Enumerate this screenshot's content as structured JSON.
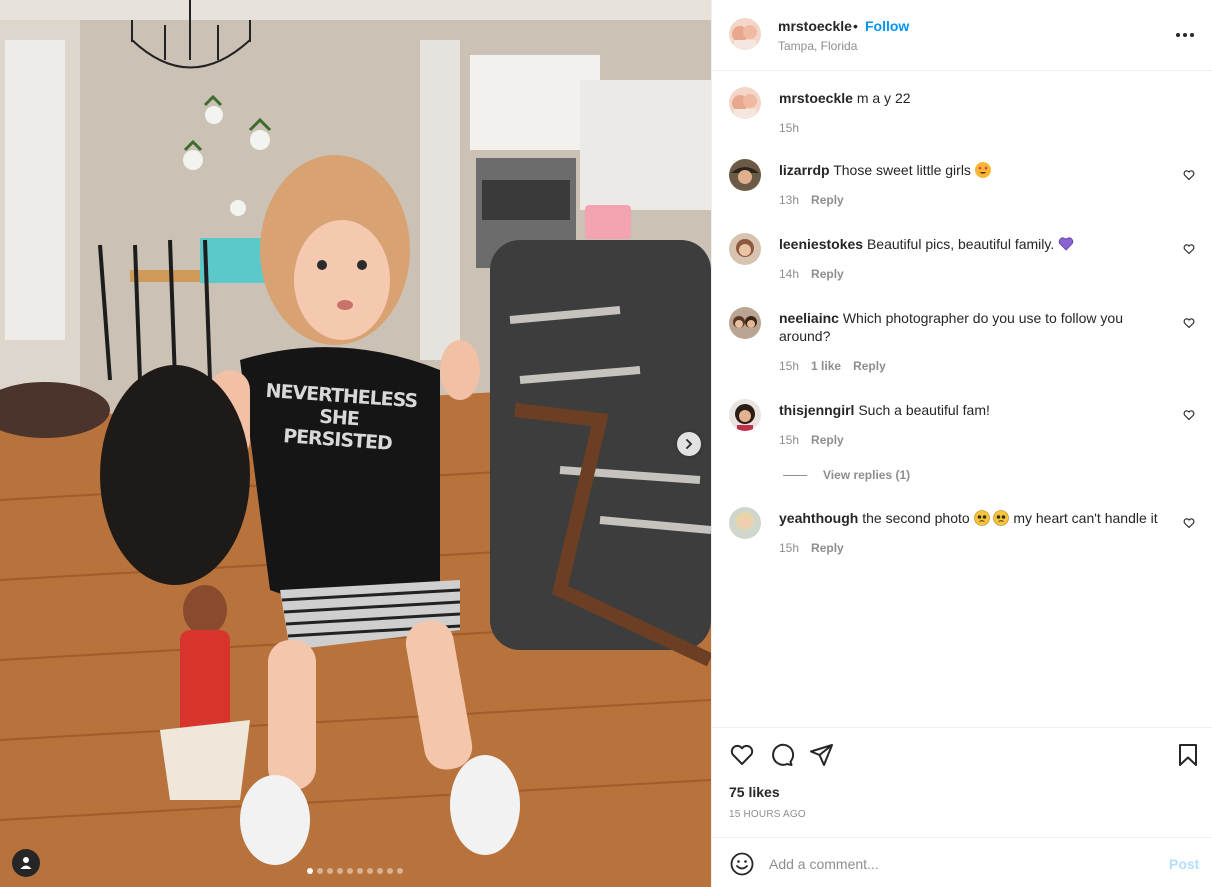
{
  "post": {
    "author": "mrstoeckle",
    "separator": "•",
    "follow_label": "Follow",
    "location": "Tampa, Florida",
    "caption": "m a y 22",
    "caption_time": "15h",
    "shirt_text": "NEVERTHELESS SHE PERSISTED",
    "carousel": {
      "slide_count": 10,
      "active_index": 0
    }
  },
  "comments": [
    {
      "username": "lizarrdp",
      "text": "Those sweet little girls",
      "emoji": "heart-eyes",
      "time": "13h",
      "likes": "",
      "reply_label": "Reply"
    },
    {
      "username": "leeniestokes",
      "text": "Beautiful pics, beautiful family.",
      "emoji": "purple-heart",
      "time": "14h",
      "likes": "",
      "reply_label": "Reply"
    },
    {
      "username": "neeliainc",
      "text": "Which photographer do you use to follow you around?",
      "emoji": "",
      "time": "15h",
      "likes": "1 like",
      "reply_label": "Reply"
    },
    {
      "username": "thisjenngirl",
      "text": "Such a beautiful fam!",
      "emoji": "",
      "time": "15h",
      "likes": "",
      "reply_label": "Reply",
      "view_replies": "View replies (1)"
    },
    {
      "username": "yeahthough",
      "text_before": "the second photo",
      "text_after": "my heart can't handle it",
      "emoji": "pleading-face",
      "time": "15h",
      "likes": "",
      "reply_label": "Reply"
    }
  ],
  "actions": {
    "likes": "75 likes",
    "time": "15 HOURS AGO",
    "icons": [
      "heart-icon",
      "comment-icon",
      "share-icon",
      "bookmark-icon"
    ]
  },
  "composer": {
    "placeholder": "Add a comment...",
    "post_label": "Post"
  },
  "colors": {
    "link": "#0095f6",
    "post_disabled": "#b2dffc",
    "muted": "#8e8e8e",
    "text": "#262626"
  }
}
